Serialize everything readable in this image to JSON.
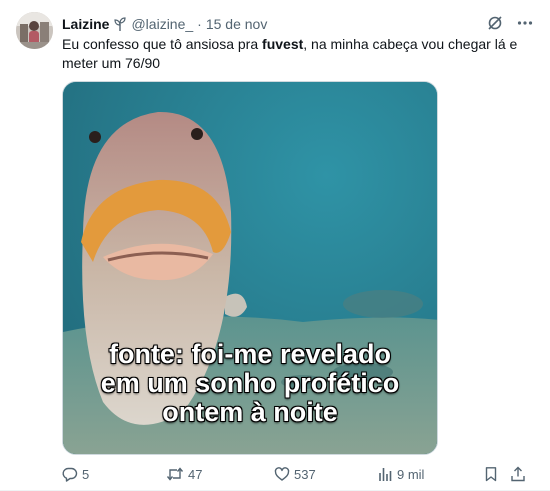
{
  "tweet": {
    "author_name": "Laizine",
    "handle": "@laizine_",
    "separator": "·",
    "date": "15 de nov",
    "text_before": "Eu confesso que tô ansiosa pra ",
    "text_bold": "fuvest",
    "text_after": ", na minha cabeça vou chegar lá e meter um 76/90",
    "media": {
      "caption_lines": [
        "fonte: foi-me revelado",
        "em um sonho profético",
        "ontem à noite"
      ]
    },
    "actions": {
      "replies": "5",
      "reposts": "47",
      "likes": "537",
      "views": "9 mil"
    }
  },
  "icons": {
    "header_decoration": "seedling-icon",
    "grok": "grok-icon",
    "more": "more-dots-icon",
    "reply": "reply-icon",
    "repost": "repost-icon",
    "like": "heart-icon",
    "views": "analytics-icon",
    "bookmark": "bookmark-icon",
    "share": "share-icon"
  },
  "colors": {
    "text_primary": "#0f1419",
    "text_secondary": "#536471",
    "border": "#cfd9de"
  }
}
